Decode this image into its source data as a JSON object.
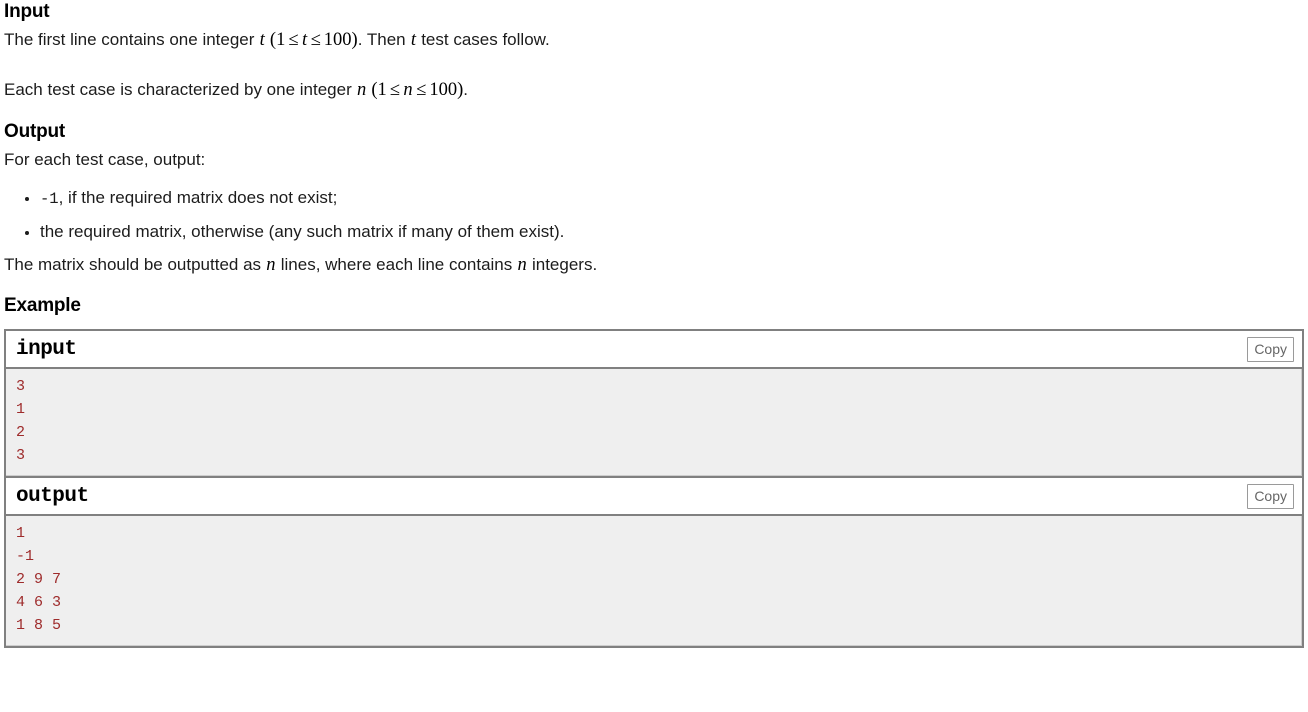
{
  "sections": {
    "input": {
      "heading": "Input",
      "paragraph1": {
        "before": "The first line contains one integer ",
        "math_var": "t",
        "math_open": "(",
        "math_lo": "1",
        "math_le1": "≤",
        "math_mid": "t",
        "math_le2": "≤",
        "math_hi": "100",
        "math_close": ")",
        "after_period": ". Then ",
        "var2": "t",
        "tail": " test cases follow."
      },
      "paragraph2": {
        "before": "Each test case is characterized by one integer ",
        "math_var": "n",
        "math_open": "(",
        "math_lo": "1",
        "math_le1": "≤",
        "math_mid": "n",
        "math_le2": "≤",
        "math_hi": "100",
        "math_close": ")",
        "after_period": "."
      }
    },
    "output": {
      "heading": "Output",
      "lead": "For each test case, output:",
      "bullets": [
        {
          "code": "-1",
          "text": ", if the required matrix does not exist;"
        },
        {
          "code": "",
          "text": "the required matrix, otherwise (any such matrix if many of them exist)."
        }
      ],
      "closing": {
        "before": "The matrix should be outputted as ",
        "var1": "n",
        "middle": " lines, where each line contains ",
        "var2": "n",
        "after": " integers."
      }
    },
    "example": {
      "heading": "Example",
      "tests": [
        {
          "title": "input",
          "copy_label": "Copy",
          "content": "3\n1\n2\n3"
        },
        {
          "title": "output",
          "copy_label": "Copy",
          "content": "1\n-1\n2 9 7\n4 6 3\n1 8 5"
        }
      ]
    }
  },
  "colors": {
    "sample_text": "#9e2b2b",
    "sample_bg": "#efefef",
    "border": "#808080",
    "copy_text": "#666666"
  }
}
